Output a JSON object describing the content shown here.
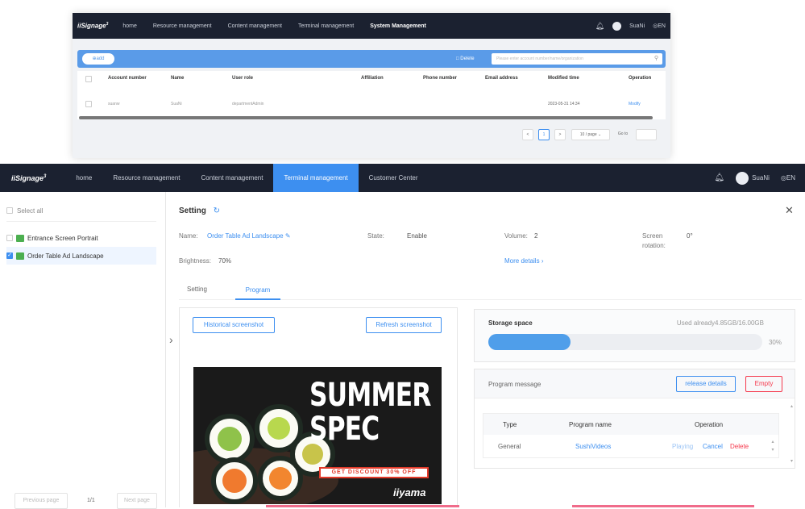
{
  "back_window": {
    "logo": "iiSignage",
    "logo_sup": "3",
    "nav": [
      "home",
      "Resource management",
      "Content management",
      "Terminal management",
      "System Management"
    ],
    "user": "SuaNi",
    "lang": "EN",
    "add_label": "add",
    "delete_label": "Delete",
    "search_placeholder": "Please enter account number/name/organization",
    "columns": [
      "Account number",
      "Name",
      "User role",
      "Affiliation",
      "Phone number",
      "Email address",
      "Modified time",
      "Operation"
    ],
    "rows": [
      {
        "account": "suanw",
        "name": "SuaNi",
        "role": "departmentAdmin",
        "affiliation": "",
        "phone": "",
        "email": "",
        "modified": "2023-05-31 14:34",
        "operation": "Modify"
      }
    ],
    "pagination": {
      "current": "1",
      "page_size": "10 / page",
      "goto_label": "Go to"
    }
  },
  "front_window": {
    "logo": "iiSignage",
    "logo_sup": "3",
    "nav": [
      "home",
      "Resource management",
      "Content management",
      "Terminal management",
      "Customer Center"
    ],
    "active_nav": "Terminal management",
    "user": "SuaNi",
    "lang": "EN",
    "sidebar": {
      "select_all": "Select all",
      "items": [
        {
          "label": "Entrance Screen Portrait",
          "checked": false
        },
        {
          "label": "Order Table Ad Landscape",
          "checked": true
        }
      ],
      "prev": "Previous page",
      "page_info": "1/1",
      "next": "Next page"
    },
    "setting": {
      "title": "Setting",
      "name_label": "Name:",
      "name_value": "Order Table Ad Landscape",
      "state_label": "State:",
      "state_value": "Enable",
      "volume_label": "Volume:",
      "volume_value": "2",
      "rotation_label_1": "Screen",
      "rotation_label_2": "rotation:",
      "rotation_value": "0°",
      "brightness_label": "Brightness:",
      "brightness_value": "70%",
      "more_details": "More details"
    },
    "tabs": [
      "Setting",
      "Program"
    ],
    "active_tab": "Program",
    "screenshot": {
      "historical": "Historical screenshot",
      "refresh": "Refresh screenshot",
      "promo_line1": "SUMMER",
      "promo_line2": "SPEC",
      "promo_banner": "GET DISCOUNT 30% OFF",
      "brand": "iiyama"
    },
    "storage": {
      "title": "Storage space",
      "used": "Used already4.85GB/16.00GB",
      "percent_text": "30%",
      "fraction": 0.3
    },
    "program": {
      "title": "Program message",
      "release_details": "release details",
      "empty": "Empty",
      "columns": [
        "Type",
        "Program name",
        "Operation"
      ],
      "rows": [
        {
          "type": "General",
          "name": "SushiVideos",
          "playing": "Playing",
          "cancel": "Cancel",
          "delete": "Delete"
        }
      ]
    }
  },
  "colors": {
    "nav_bg": "#1b2130",
    "accent": "#3d8ff0",
    "danger": "#f5384c"
  }
}
